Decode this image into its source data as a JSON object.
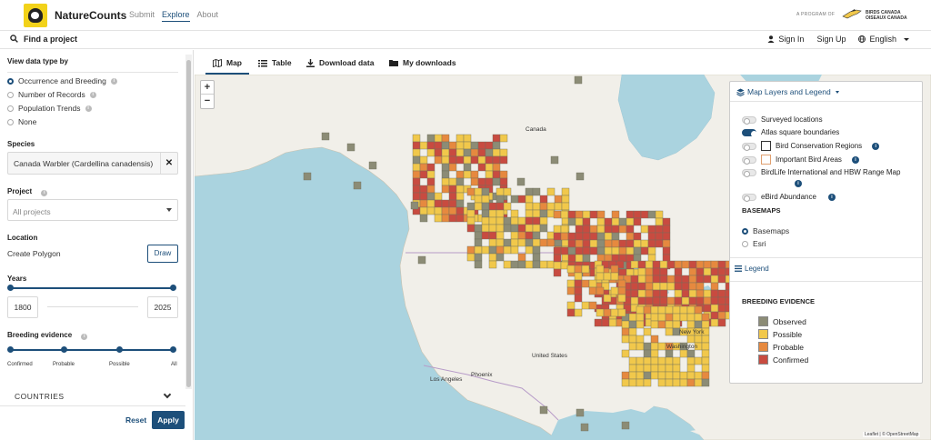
{
  "header": {
    "brand": "NatureCounts",
    "nav": [
      "Submit",
      "Explore",
      "About"
    ],
    "active_nav": "Explore",
    "program_text": "A PROGRAM OF",
    "partner_line1": "BIRDS CANADA",
    "partner_line2": "OISEAUX CANADA"
  },
  "subheader": {
    "find_project": "Find a project",
    "sign_in": "Sign In",
    "sign_up": "Sign Up",
    "language": "English"
  },
  "sidebar": {
    "data_type_heading": "View data type by",
    "data_types": [
      "Occurrence and Breeding",
      "Number of Records",
      "Population Trends",
      "None"
    ],
    "selected_data_type": "Occurrence and Breeding",
    "species_heading": "Species",
    "species_value": "Canada Warbler (Cardellina canadensis)",
    "project_heading": "Project",
    "project_placeholder": "All projects",
    "location_heading": "Location",
    "create_polygon": "Create Polygon",
    "draw_label": "Draw",
    "years_heading": "Years",
    "year_from": "1800",
    "year_to": "2025",
    "breeding_heading": "Breeding evidence",
    "breeding_ticks": [
      "Confirmed",
      "Probable",
      "Possible",
      "All"
    ],
    "countries_label": "COUNTRIES",
    "reset_label": "Reset",
    "apply_label": "Apply"
  },
  "tabs": {
    "map": "Map",
    "table": "Table",
    "download": "Download data",
    "my_downloads": "My downloads",
    "active": "Map"
  },
  "map": {
    "zoom_in": "+",
    "zoom_out": "−",
    "labels": {
      "canada": "Canada",
      "united_states": "United States",
      "washington": "Washington",
      "new_york": "New York",
      "phoenix": "Phoenix",
      "los_angeles": "Los Angeles"
    },
    "attribution": "Leaflet | © OpenStreetMap"
  },
  "layers_panel": {
    "title": "Map Layers and Legend",
    "layers": [
      {
        "label": "Surveyed locations",
        "on": false
      },
      {
        "label": "Atlas square boundaries",
        "on": true
      },
      {
        "label": "Bird Conservation Regions",
        "on": false
      },
      {
        "label": "Important Bird Areas",
        "on": false
      },
      {
        "label": "BirdLife International and HBW Range Map",
        "on": false
      },
      {
        "label": "eBird Abundance",
        "on": false
      }
    ],
    "basemaps_heading": "BASEMAPS",
    "basemaps": [
      "Basemaps",
      "Esri"
    ],
    "selected_basemap": "Basemaps",
    "legend_label": "Legend",
    "breeding_heading": "BREEDING EVIDENCE",
    "legend": [
      {
        "label": "Observed",
        "color": "#8c8c76"
      },
      {
        "label": "Possible",
        "color": "#f1c84b"
      },
      {
        "label": "Probable",
        "color": "#e6893f"
      },
      {
        "label": "Confirmed",
        "color": "#c84b40"
      }
    ]
  },
  "colors": {
    "accent": "#1d4f7a",
    "water": "#aad3df",
    "land": "#f1efe9"
  }
}
